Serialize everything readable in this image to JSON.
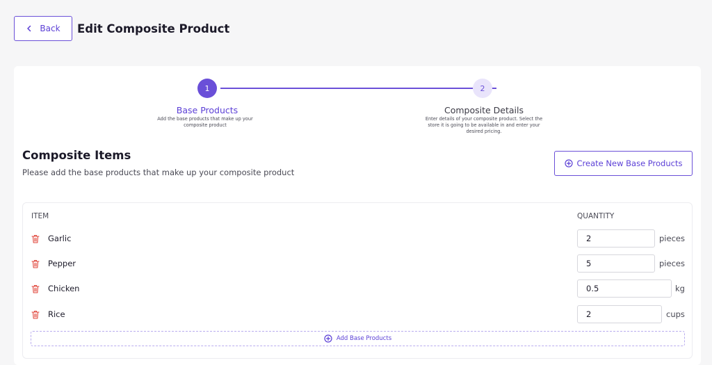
{
  "header": {
    "back_label": "Back",
    "title": "Edit Composite Product"
  },
  "stepper": {
    "steps": [
      {
        "number": "1",
        "title": "Base Products",
        "description": "Add the base products that make up your composite product"
      },
      {
        "number": "2",
        "title": "Composite Details",
        "description": "Enter details of your composite product. Select the store it is going to be available in and enter your desired pricing."
      }
    ],
    "active_step": 1
  },
  "section": {
    "title": "Composite Items",
    "subtitle": "Please add the base products that make up your composite product",
    "create_button_label": "Create New Base Products"
  },
  "table": {
    "columns": {
      "item": "ITEM",
      "quantity": "QUANTITY"
    },
    "rows": [
      {
        "name": "Garlic",
        "quantity": "2",
        "unit": "pieces"
      },
      {
        "name": "Pepper",
        "quantity": "5",
        "unit": "pieces"
      },
      {
        "name": "Chicken",
        "quantity": "0.5",
        "unit": "kg"
      },
      {
        "name": "Rice",
        "quantity": "2",
        "unit": "cups"
      }
    ],
    "add_button_label": "Add Base Products"
  },
  "colors": {
    "accent": "#6a4fd8",
    "danger": "#e0453a",
    "step_inactive_bg": "#e9e4fb"
  },
  "icons": {
    "back": "chevron-left-icon",
    "add": "plus-circle-icon",
    "delete": "trash-icon"
  }
}
